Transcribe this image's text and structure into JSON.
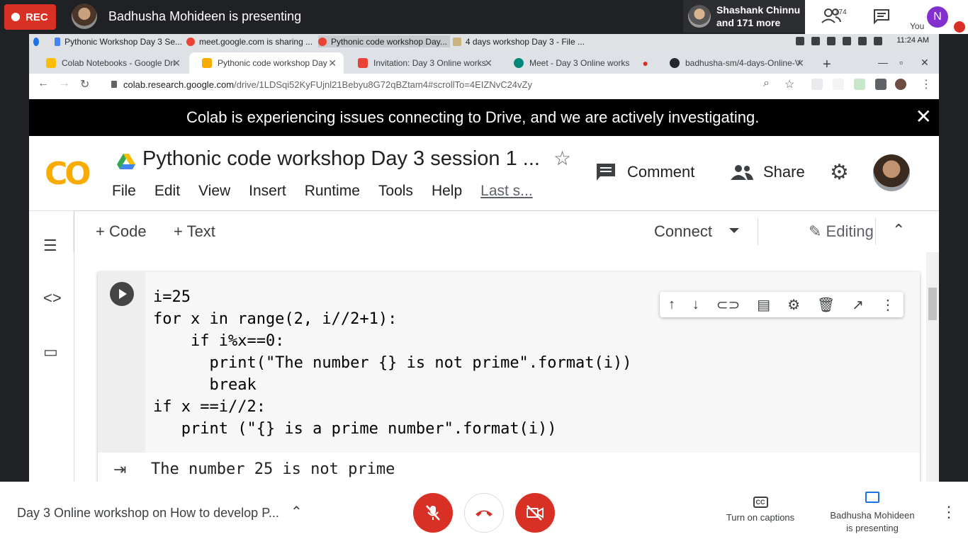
{
  "meet": {
    "rec_label": "REC",
    "presenting_title": "Badhusha Mohideen is presenting",
    "participants_name": "Shashank Chinnu",
    "participants_more": "and 171 more",
    "people_count": "174",
    "you_initial": "N",
    "you_label": "You",
    "meeting_title": "Day 3 Online workshop on How to develop P...",
    "captions_label": "Turn on captions",
    "presenting_line1": "Badhusha Mohideen",
    "presenting_line2": "is presenting"
  },
  "os": {
    "tabs": [
      "Pythonic Workshop Day 3 Se...",
      "meet.google.com is sharing ...",
      "Pythonic code workshop Day...",
      "4 days workshop Day 3 - File ..."
    ],
    "clock": "11:24 AM"
  },
  "browser": {
    "tabs": [
      "Colab Notebooks - Google Dri",
      "Pythonic code workshop Day",
      "Invitation: Day 3 Online works",
      "Meet - Day 3 Online works",
      "badhusha-sm/4-days-Online-V"
    ],
    "url_host": "colab.research.google.com",
    "url_path": "/drive/1LDSqi52KyFUjnl21Bebyu8G72qBZtam4#scrollTo=4EIZNvC24vZy"
  },
  "colab": {
    "banner": "Colab is experiencing issues connecting to Drive, and we are actively investigating.",
    "logo": "CO",
    "title": "Pythonic code workshop Day 3 session 1 ...",
    "menu": [
      "File",
      "Edit",
      "View",
      "Insert",
      "Runtime",
      "Tools",
      "Help"
    ],
    "last_saved": "Last s...",
    "comment": "Comment",
    "share": "Share",
    "add_code": "+ Code",
    "add_text": "+ Text",
    "connect": "Connect",
    "editing": "Editing",
    "code_lines": [
      "i=25",
      "for x in range(2, i//2+1):",
      "    if i%x==0:",
      "      print(\"The number {} is not prime\".format(i))",
      "      break",
      "if x ==i//2:",
      "   print (\"{} is a prime number\".format(i))"
    ],
    "output": "The number 25 is not prime"
  }
}
